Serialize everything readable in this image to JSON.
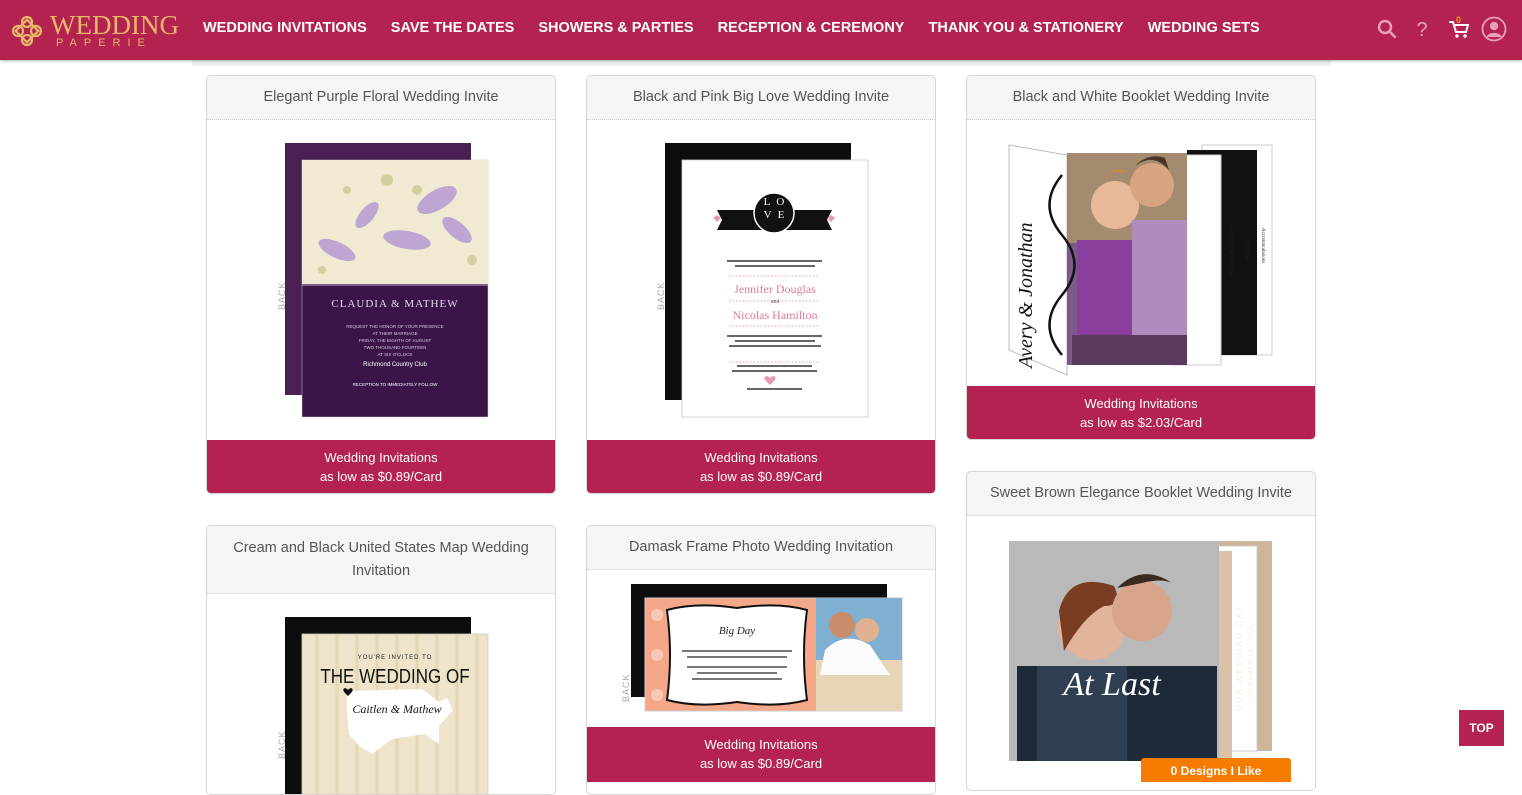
{
  "brand": {
    "word1": "WEDDING",
    "word2": "PAPERIE",
    "color": "#e8b769"
  },
  "theme": {
    "primary": "#b4234f",
    "accent_orange": "#f57c00"
  },
  "nav": [
    "WEDDING INVITATIONS",
    "SAVE THE DATES",
    "SHOWERS & PARTIES",
    "RECEPTION & CEREMONY",
    "THANK YOU & STATIONERY",
    "WEDDING SETS"
  ],
  "tools": {
    "search_icon": "search-icon",
    "help_icon": "help-icon",
    "cart_icon": "cart-icon",
    "cart_count": "0",
    "account_icon": "user-icon"
  },
  "cards": [
    {
      "title": "Elegant Purple Floral Wedding Invite",
      "category": "Wedding Invitations",
      "price": "as low as $0.89/Card",
      "back": "BACK",
      "art": {
        "names": "CLAUDIA & MATHEW",
        "lines": [
          "REQUEST THE HONOR OF YOUR PRESENCE",
          "AT THEIR MARRIAGE",
          "FRIDAY, THE EIGHTH OF AUGUST",
          "TWO THOUSAND FOURTEEN",
          "AT SIX O'CLOCK",
          "Richmond Country Club",
          "RECEPTION TO IMMEDIATELY FOLLOW"
        ]
      }
    },
    {
      "title": "Black and Pink Big Love Wedding Invite",
      "category": "Wedding Invitations",
      "price": "as low as $0.89/Card",
      "back": "BACK",
      "art": {
        "love": "LOVE",
        "name1": "Jennifer Douglas",
        "and": "and",
        "name2": "Nicolas Hamilton"
      }
    },
    {
      "title": "Black and White Booklet Wedding Invite",
      "category": "Wedding Invitations",
      "price": "as low as $2.03/Card",
      "art": {
        "names": "Avery & Jonathan",
        "tabs": [
          "Ceremony & Reception",
          "Directions",
          "Accommodations"
        ]
      }
    },
    {
      "title": "Cream and Black United States Map Wedding Invitation",
      "back": "BACK",
      "art": {
        "invited": "YOU'RE INVITED TO",
        "heading": "THE WEDDING OF",
        "names": "Caitlen & Mathew"
      }
    },
    {
      "title": "Damask Frame Photo Wedding Invitation",
      "category": "Wedding Invitations",
      "price": "as low as $0.89/Card",
      "back": "BACK",
      "art": {
        "script": "Big Day"
      }
    },
    {
      "title": "Sweet Brown Elegance Booklet Wedding Invite",
      "art": {
        "script": "At Last",
        "side1": "OUR WEDDING DAY",
        "side2": "DECEMBER 18, 2016"
      }
    }
  ],
  "top_button": "TOP",
  "designs_button": "0 Designs I Like"
}
